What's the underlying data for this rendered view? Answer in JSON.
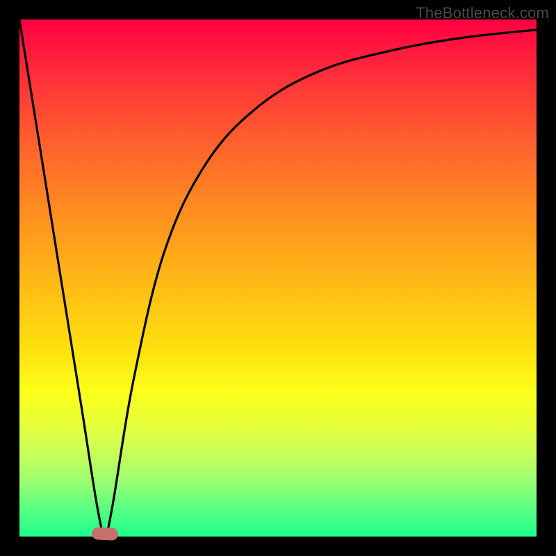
{
  "watermark": {
    "text": "TheBottleneck.com"
  },
  "colors": {
    "frame": "#000000",
    "marker": "#c76f6d",
    "curve": "#000000",
    "gradient_stops": [
      "#ff0042",
      "#ff2b3b",
      "#ff5a2f",
      "#ff8a21",
      "#ffb716",
      "#ffe10e",
      "#fbff1a",
      "#e8ff38",
      "#c7ff5a",
      "#94ff73",
      "#54ff84",
      "#1dff8c"
    ]
  },
  "chart_data": {
    "type": "line",
    "title": "",
    "xlabel": "",
    "ylabel": "",
    "xlim": [
      0,
      100
    ],
    "ylim": [
      0,
      100
    ],
    "grid": false,
    "series": [
      {
        "name": "bottleneck-curve",
        "x": [
          0,
          4,
          8,
          12,
          15,
          16.5,
          18,
          22,
          28,
          36,
          46,
          58,
          72,
          86,
          100
        ],
        "y": [
          100,
          75,
          50,
          25,
          6,
          0.5,
          6,
          30,
          55,
          72,
          83,
          90,
          94,
          96.5,
          98
        ]
      }
    ],
    "marker": {
      "x": 16.5,
      "y": 0.5,
      "shape": "pill",
      "color": "#c76f6d"
    },
    "legend": false
  }
}
